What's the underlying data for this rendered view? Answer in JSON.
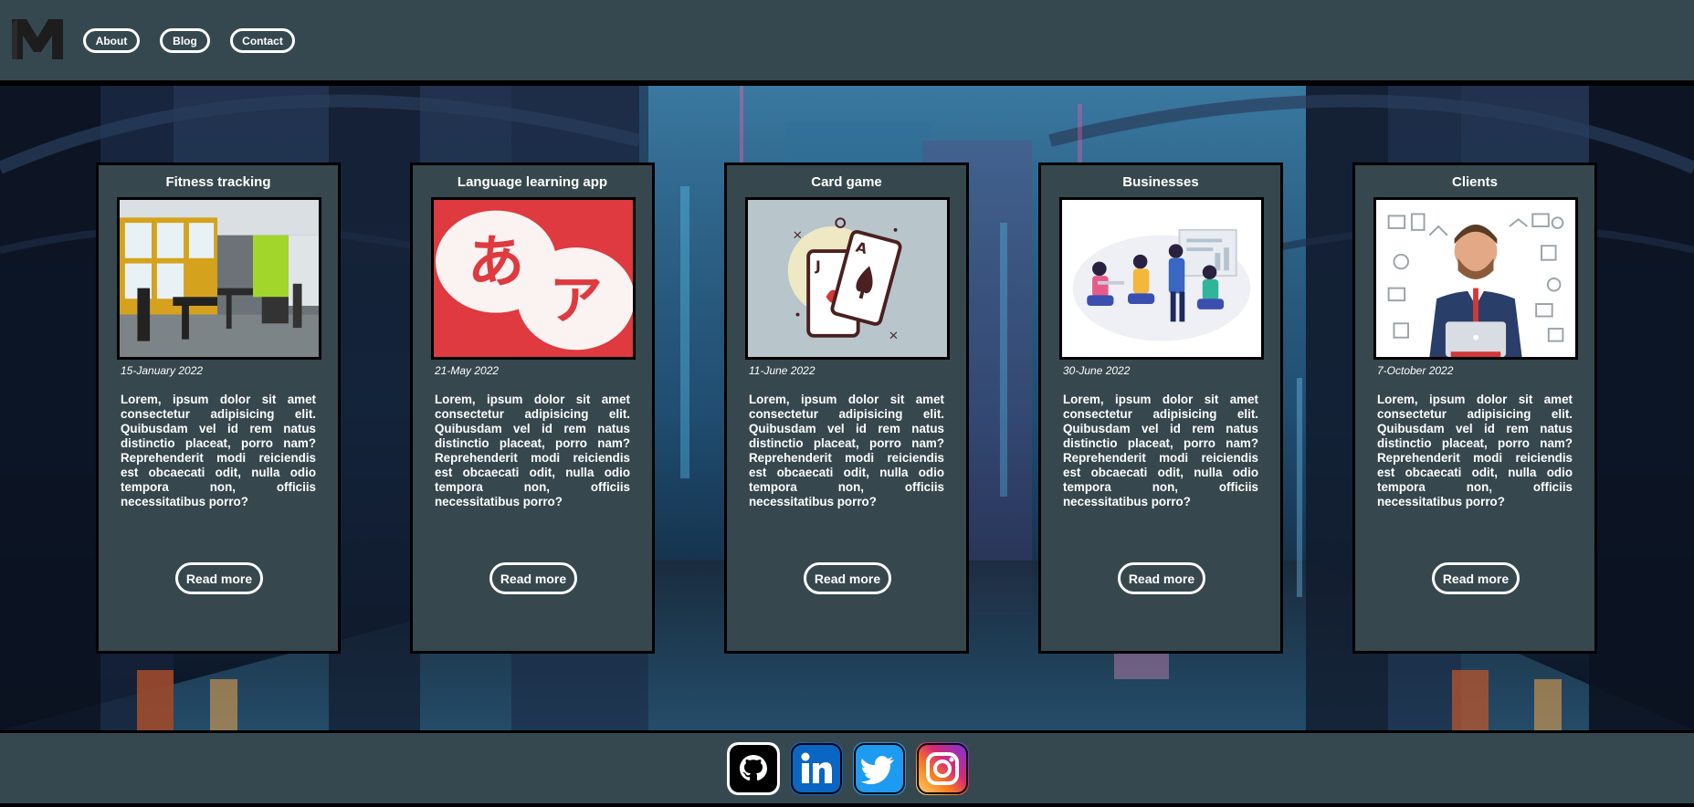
{
  "header": {
    "logo": "M",
    "nav": [
      {
        "label": "About"
      },
      {
        "label": "Blog"
      },
      {
        "label": "Contact"
      }
    ]
  },
  "cards": [
    {
      "title": "Fitness tracking",
      "date": "15-January 2022",
      "image": "gym-photo",
      "text": "Lorem, ipsum dolor sit amet consectetur adipisicing elit. Quibusdam vel id rem natus distinctio placeat, porro nam? Reprehenderit modi reiciendis est obcaecati odit, nulla odio tempora non, officiis necessitatibus porro?",
      "button": "Read more"
    },
    {
      "title": "Language learning app",
      "date": "21-May 2022",
      "image": "japanese-kana-illustration",
      "text": "Lorem, ipsum dolor sit amet consectetur adipisicing elit. Quibusdam vel id rem natus distinctio placeat, porro nam? Reprehenderit modi reiciendis est obcaecati odit, nulla odio tempora non, officiis necessitatibus porro?",
      "button": "Read more",
      "image_text": [
        "あ",
        "ア"
      ]
    },
    {
      "title": "Card game",
      "date": "11-June 2022",
      "image": "playing-cards-illustration",
      "text": "Lorem, ipsum dolor sit amet consectetur adipisicing elit. Quibusdam vel id rem natus distinctio placeat, porro nam? Reprehenderit modi reiciendis est obcaecati odit, nulla odio tempora non, officiis necessitatibus porro?",
      "button": "Read more"
    },
    {
      "title": "Businesses",
      "date": "30-June 2022",
      "image": "business-meeting-illustration",
      "text": "Lorem, ipsum dolor sit amet consectetur adipisicing elit. Quibusdam vel id rem natus distinctio placeat, porro nam? Reprehenderit modi reiciendis est obcaecati odit, nulla odio tempora non, officiis necessitatibus porro?",
      "button": "Read more"
    },
    {
      "title": "Clients",
      "date": "7-October 2022",
      "image": "client-businessman-illustration",
      "text": "Lorem, ipsum dolor sit amet consectetur adipisicing elit. Quibusdam vel id rem natus distinctio placeat, porro nam? Reprehenderit modi reiciendis est obcaecati odit, nulla odio tempora non, officiis necessitatibus porro?",
      "button": "Read more"
    }
  ],
  "footer": {
    "social": [
      {
        "icon": "github-icon",
        "color": "#000000"
      },
      {
        "icon": "linkedin-icon",
        "color": "#0a66c2"
      },
      {
        "icon": "twitter-icon",
        "color": "#1d9bf0"
      },
      {
        "icon": "instagram-icon",
        "color": "#e1306c"
      }
    ]
  },
  "colors": {
    "panel": "#36484f",
    "card": "#36474e",
    "border": "#000000",
    "text": "#ffffff"
  }
}
